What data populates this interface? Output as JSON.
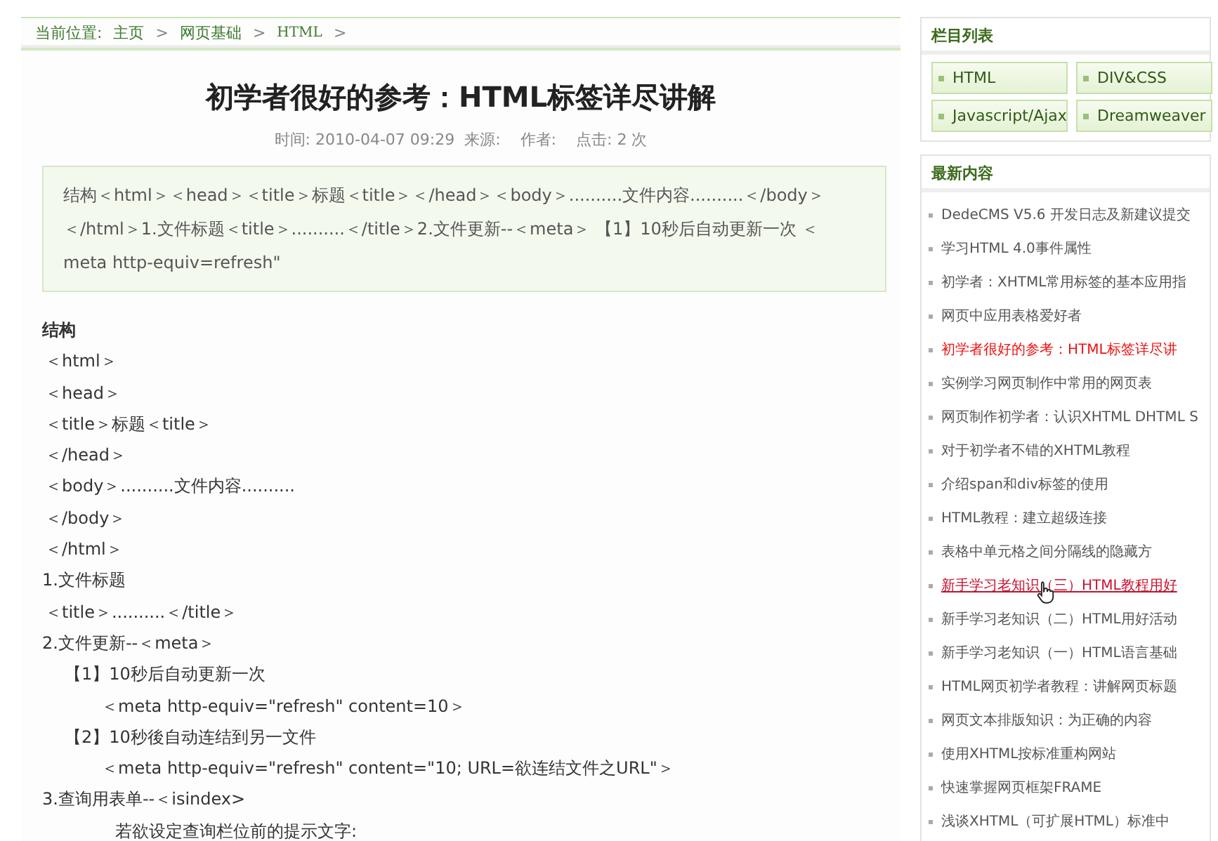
{
  "breadcrumb": {
    "label": "当前位置:",
    "items": [
      "主页",
      "网页基础",
      "HTML"
    ],
    "separator": ">"
  },
  "article": {
    "title": "初学者很好的参考：HTML标签详尽讲解",
    "meta": "时间: 2010-04-07 09:29  来源:    作者:    点击: 2 次",
    "summary": "结构＜html＞＜head＞＜title＞标题＜title＞＜/head＞＜body＞..........文件内容..........＜/body＞＜/html＞1.文件标题＜title＞..........＜/title＞2.文件更新--＜meta＞ 【1】10秒后自动更新一次 ＜meta http-equiv=refresh\"",
    "lines": [
      {
        "kind": "heading",
        "text": "结构"
      },
      {
        "kind": "line",
        "text": "＜html＞"
      },
      {
        "kind": "line",
        "text": "＜head＞"
      },
      {
        "kind": "line",
        "text": "＜title＞标题＜title＞"
      },
      {
        "kind": "line",
        "text": "＜/head＞"
      },
      {
        "kind": "line",
        "text": "＜body＞..........文件内容.........."
      },
      {
        "kind": "line",
        "text": "＜/body＞"
      },
      {
        "kind": "line",
        "text": "＜/html＞"
      },
      {
        "kind": "step",
        "text": "1.文件标题"
      },
      {
        "kind": "line",
        "text": "＜title＞..........＜/title＞"
      },
      {
        "kind": "step",
        "text": "2.文件更新--＜meta＞"
      },
      {
        "kind": "substep",
        "text": "【1】10秒后自动更新一次"
      },
      {
        "kind": "code",
        "text": "＜meta http-equiv=\"refresh\" content=10＞"
      },
      {
        "kind": "substep",
        "text": "【2】10秒後自动连结到另一文件"
      },
      {
        "kind": "code",
        "text": "＜meta http-equiv=\"refresh\" content=\"10; URL=欲连结文件之URL\"＞"
      },
      {
        "kind": "step",
        "text": "3.查询用表单--＜isindex>"
      },
      {
        "kind": "hint",
        "text": "若欲设定查询栏位前的提示文字:"
      }
    ]
  },
  "sidebar": {
    "categories": {
      "title": "栏目列表",
      "items": [
        "HTML",
        "DIV&CSS",
        "Javascript/Ajax",
        "Dreamweaver"
      ]
    },
    "latest": {
      "title": "最新内容",
      "items": [
        {
          "text": "DedeCMS V5.6 开发日志及新建议提交",
          "current": false,
          "hovered": false
        },
        {
          "text": "学习HTML 4.0事件属性",
          "current": false,
          "hovered": false
        },
        {
          "text": "初学者：XHTML常用标签的基本应用指",
          "current": false,
          "hovered": false
        },
        {
          "text": "网页中应用表格爱好者",
          "current": false,
          "hovered": false
        },
        {
          "text": "初学者很好的参考：HTML标签详尽讲",
          "current": true,
          "hovered": false
        },
        {
          "text": "实例学习网页制作中常用的网页表",
          "current": false,
          "hovered": false
        },
        {
          "text": "网页制作初学者：认识XHTML DHTML S",
          "current": false,
          "hovered": false
        },
        {
          "text": "对于初学者不错的XHTML教程",
          "current": false,
          "hovered": false
        },
        {
          "text": "介绍span和div标签的使用",
          "current": false,
          "hovered": false
        },
        {
          "text": "HTML教程：建立超级连接",
          "current": false,
          "hovered": false
        },
        {
          "text": "表格中单元格之间分隔线的隐藏方",
          "current": false,
          "hovered": false
        },
        {
          "text": "新手学习老知识（三）HTML教程用好",
          "current": false,
          "hovered": true
        },
        {
          "text": "新手学习老知识（二）HTML用好活动",
          "current": false,
          "hovered": false
        },
        {
          "text": "新手学习老知识（一）HTML语言基础",
          "current": false,
          "hovered": false
        },
        {
          "text": "HTML网页初学者教程：讲解网页标题",
          "current": false,
          "hovered": false
        },
        {
          "text": "网页文本排版知识：为正确的内容",
          "current": false,
          "hovered": false
        },
        {
          "text": "使用XHTML按标准重构网站",
          "current": false,
          "hovered": false
        },
        {
          "text": "快速掌握网页框架FRAME",
          "current": false,
          "hovered": false
        },
        {
          "text": "浅谈XHTML（可扩展HTML）标准中",
          "current": false,
          "hovered": false
        }
      ]
    }
  }
}
